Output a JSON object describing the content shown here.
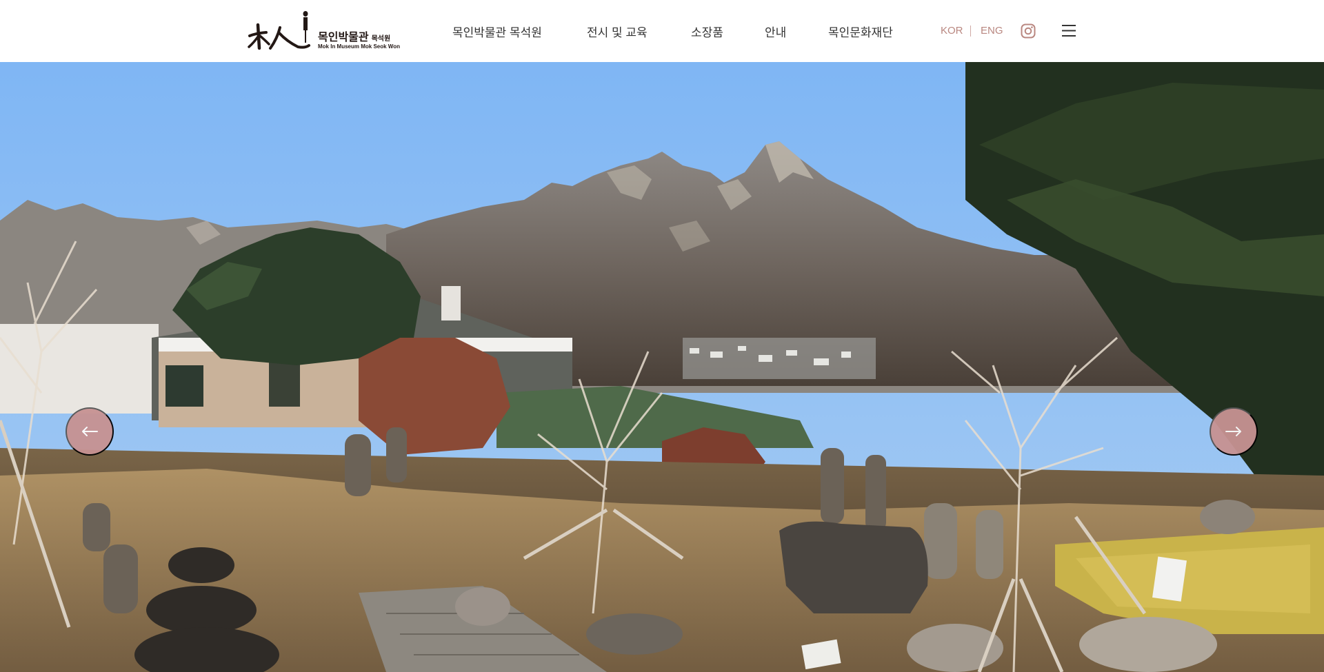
{
  "site": {
    "logo_title_ko": "목인박물관",
    "logo_subtitle_ko": "목석원",
    "logo_title_en": "Mok In Museum Mok Seok Won"
  },
  "nav": {
    "items": [
      {
        "label": "목인박물관 목석원"
      },
      {
        "label": "전시 및 교육"
      },
      {
        "label": "소장품"
      },
      {
        "label": "안내"
      },
      {
        "label": "목인문화재단"
      }
    ]
  },
  "lang": {
    "kor": "KOR",
    "eng": "ENG"
  },
  "icons": {
    "instagram": "instagram-icon",
    "menu": "hamburger-menu-icon",
    "prev": "arrow-left-icon",
    "next": "arrow-right-icon"
  },
  "colors": {
    "accent": "#c79292",
    "lang_text": "#b98780",
    "nav_text": "#333333"
  },
  "hero": {
    "slide_description": "Mountain peak over outdoor garden with stone statues"
  }
}
